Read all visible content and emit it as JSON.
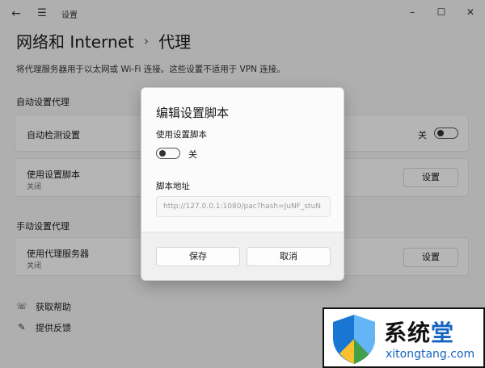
{
  "window": {
    "title": "设置",
    "back_icon": "back-arrow-icon",
    "menu_icon": "hamburger-icon"
  },
  "header": {
    "section": "网络和 Internet",
    "separator": "›",
    "page": "代理"
  },
  "description": "将代理服务器用于以太网或 Wi-Fi 连接。这些设置不适用于 VPN 连接。",
  "auto_proxy": {
    "title": "自动设置代理",
    "detect": {
      "label": "自动检测设置",
      "toggle_label": "关",
      "toggle_on": false
    },
    "script": {
      "label": "使用设置脚本",
      "status": "关闭",
      "button": "设置"
    }
  },
  "manual_proxy": {
    "title": "手动设置代理",
    "server": {
      "label": "使用代理服务器",
      "status": "关闭",
      "button": "设置"
    }
  },
  "help": {
    "get_help": "获取帮助",
    "feedback": "提供反馈"
  },
  "dialog": {
    "title": "编辑设置脚本",
    "use_script_label": "使用设置脚本",
    "toggle_label": "关",
    "toggle_on": false,
    "address_label": "脚本地址",
    "address_value": "http://127.0.0.1:1080/pac?hash=JuNF_stuN",
    "save": "保存",
    "cancel": "取消"
  },
  "watermark": {
    "brand_part1": "系统",
    "brand_part2": "堂",
    "url": "xitongtang.com",
    "colors": {
      "shield_blue": "#1976d2",
      "shield_green": "#43a047",
      "accent": "#1565c0"
    }
  }
}
